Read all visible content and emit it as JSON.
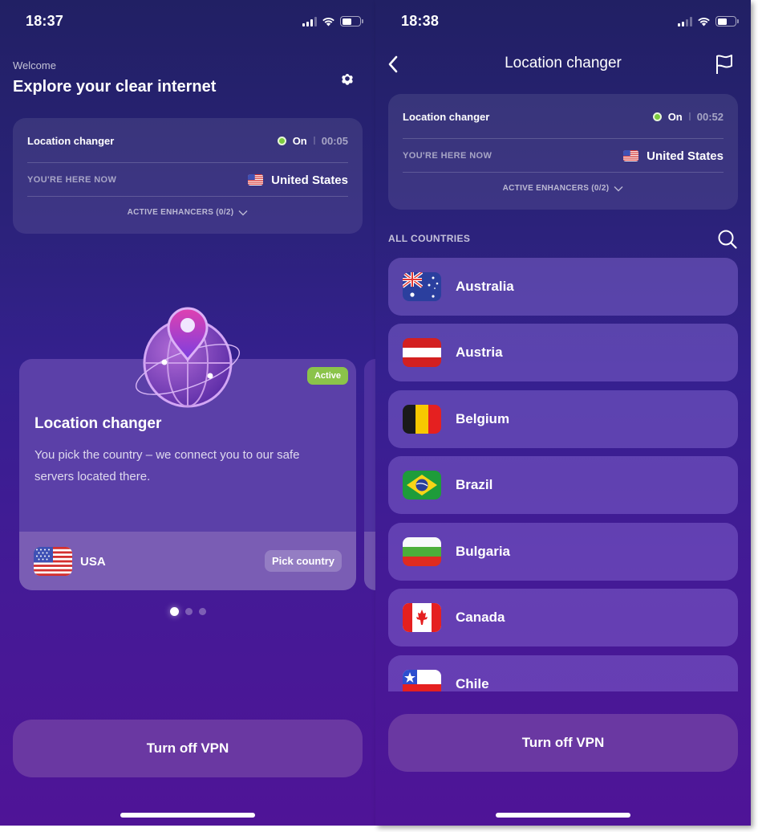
{
  "left_screen": {
    "status_bar": {
      "time": "18:37",
      "icons": [
        "cellular-signal-icon",
        "wifi-icon",
        "battery-icon"
      ]
    },
    "header": {
      "welcome": "Welcome",
      "headline": "Explore your clear internet",
      "settings_icon": "gear-icon"
    },
    "status_card": {
      "title": "Location changer",
      "state": "On",
      "timer": "00:05",
      "location_label": "YOU'RE HERE NOW",
      "location_value": "United States",
      "enhancers": "ACTIVE ENHANCERS (0/2)"
    },
    "feature_card": {
      "badge": "Active",
      "title": "Location changer",
      "description": "You pick the country – we connect you to our safe servers located there.",
      "country": "USA",
      "pick_button": "Pick country"
    },
    "pager": {
      "total": 3,
      "active": 1
    },
    "vpn_button": "Turn off VPN"
  },
  "right_screen": {
    "status_bar": {
      "time": "18:38",
      "icons": [
        "cellular-signal-icon",
        "wifi-icon",
        "battery-icon"
      ]
    },
    "nav": {
      "title": "Location changer",
      "back_icon": "chevron-left-icon",
      "report_icon": "flag-icon"
    },
    "status_card": {
      "title": "Location changer",
      "state": "On",
      "timer": "00:52",
      "location_label": "YOU'RE HERE NOW",
      "location_value": "United States",
      "enhancers": "ACTIVE ENHANCERS (0/2)"
    },
    "countries_label": "ALL COUNTRIES",
    "countries": [
      {
        "name": "Australia",
        "flag": "au"
      },
      {
        "name": "Austria",
        "flag": "at"
      },
      {
        "name": "Belgium",
        "flag": "be"
      },
      {
        "name": "Brazil",
        "flag": "br"
      },
      {
        "name": "Bulgaria",
        "flag": "bg"
      },
      {
        "name": "Canada",
        "flag": "ca"
      },
      {
        "name": "Chile",
        "flag": "cl"
      }
    ],
    "vpn_button": "Turn off VPN"
  },
  "colors": {
    "status_on": "#7ccb3f",
    "badge_active": "#8bc34a",
    "button_bg": "#6a38a2"
  }
}
